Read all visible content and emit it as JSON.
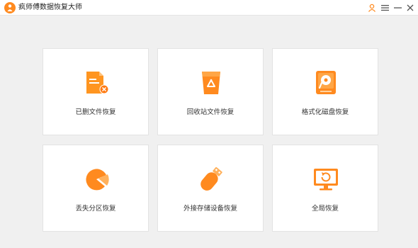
{
  "app": {
    "title": "疯师傅数据恢复大师",
    "accent_color": "#ff8a1f",
    "logo_icon": "app-logo-icon"
  },
  "titlebar": {
    "buttons": [
      {
        "name": "user-icon"
      },
      {
        "name": "menu-icon"
      },
      {
        "name": "minimize-icon"
      },
      {
        "name": "close-icon"
      }
    ]
  },
  "cards": [
    {
      "label": "已删文件恢复",
      "icon": "deleted-file-icon"
    },
    {
      "label": "回收站文件恢复",
      "icon": "recycle-bin-icon"
    },
    {
      "label": "格式化磁盘恢复",
      "icon": "format-disk-icon"
    },
    {
      "label": "丢失分区恢复",
      "icon": "lost-partition-icon"
    },
    {
      "label": "外接存储设备恢复",
      "icon": "usb-drive-icon"
    },
    {
      "label": "全局恢复",
      "icon": "global-restore-icon"
    }
  ]
}
